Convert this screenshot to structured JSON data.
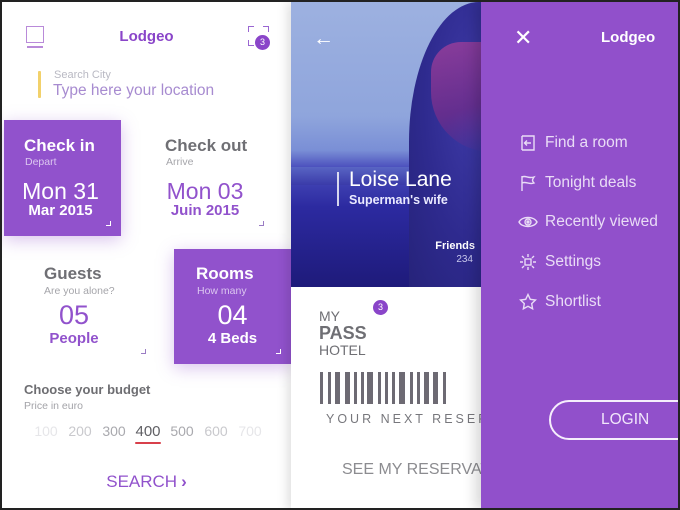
{
  "search_screen": {
    "brand": "Lodgeo",
    "notification_count": "3",
    "search": {
      "label": "Search City",
      "placeholder": "Type here your location"
    },
    "check_in": {
      "title": "Check in",
      "subtitle": "Depart",
      "day": "Mon 31",
      "month_year": "Mar 2015",
      "selected": true
    },
    "check_out": {
      "title": "Check out",
      "subtitle": "Arrive",
      "day": "Mon 03",
      "month_year": "Juin 2015",
      "selected": false
    },
    "guests": {
      "title": "Guests",
      "subtitle": "Are you alone?",
      "count": "05",
      "unit": "People",
      "selected": false
    },
    "rooms": {
      "title": "Rooms",
      "subtitle": "How many",
      "count": "04",
      "unit": "4 Beds",
      "selected": true
    },
    "budget": {
      "title": "Choose your budget",
      "subtitle": "Price in euro",
      "options": [
        "100",
        "200",
        "300",
        "400",
        "500",
        "600",
        "700"
      ],
      "selected": "400"
    },
    "search_button": "SEARCH",
    "search_button_icon": "chevron-right-icon"
  },
  "profile_screen": {
    "back_icon": "arrow-left-icon",
    "name": "Loise Lane",
    "tagline": "Superman's wife",
    "friends_label": "Friends",
    "friends_count": "234",
    "pass": {
      "badge_count": "3",
      "line1": "MY",
      "line2": "PASS",
      "line3": "HOTEL",
      "caption": "YOUR NEXT RESERVATION",
      "link": "SEE MY RESERVATIONS"
    }
  },
  "menu_screen": {
    "close_icon": "close-icon",
    "brand": "Lodgeo",
    "items": [
      {
        "label": "Find a room",
        "icon": "sign-in-icon"
      },
      {
        "label": "Tonight deals",
        "icon": "flag-icon"
      },
      {
        "label": "Recently viewed",
        "icon": "eye-icon"
      },
      {
        "label": "Settings",
        "icon": "settings-icon"
      },
      {
        "label": "Shortlist",
        "icon": "star-icon"
      }
    ],
    "login_button": "LOGIN"
  },
  "colors": {
    "accent": "#9152cc",
    "search_marker": "#f2d16b",
    "budget_underline": "#d8404b",
    "menu_bg": "#9150cb"
  }
}
